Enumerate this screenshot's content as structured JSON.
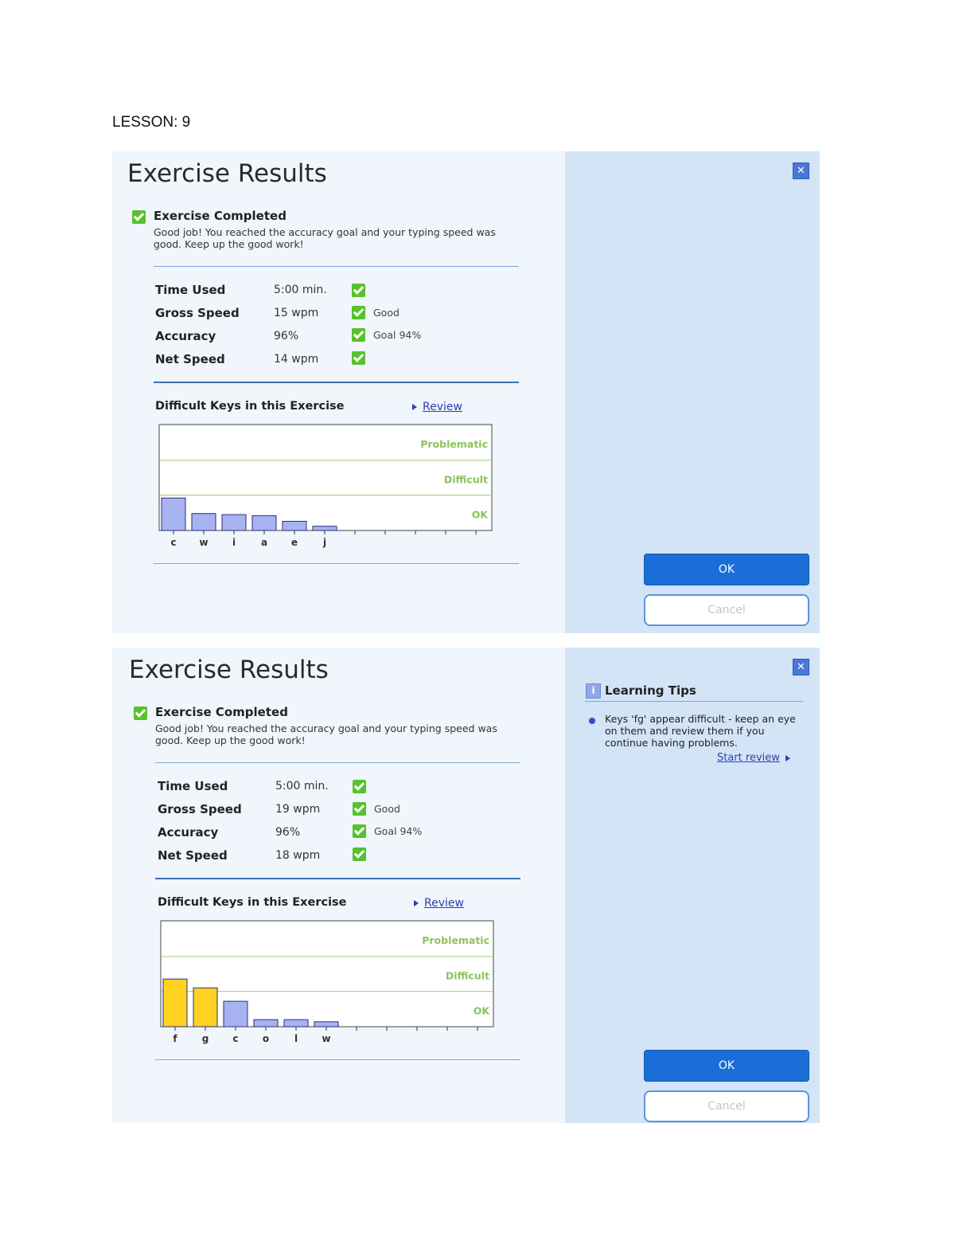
{
  "lesson_label": "LESSON: 9",
  "panels": [
    {
      "title": "Exercise Results",
      "completed_title": "Exercise Completed",
      "completed_message": "Good job! You reached the accuracy goal and your typing speed was good. Keep up the good work!",
      "stats": [
        {
          "label": "Time Used",
          "value": "5:00 min.",
          "note": ""
        },
        {
          "label": "Gross Speed",
          "value": "15 wpm",
          "note": "Good"
        },
        {
          "label": "Accuracy",
          "value": "96%",
          "note": "Goal 94%"
        },
        {
          "label": "Net Speed",
          "value": "14 wpm",
          "note": ""
        }
      ],
      "difficult_keys_title": "Difficult Keys in this Exercise",
      "review_label": "Review",
      "ok_label": "OK",
      "cancel_label": "Cancel",
      "chart_data": {
        "type": "bar",
        "categories": [
          "c",
          "w",
          "i",
          "a",
          "e",
          "j",
          "",
          "",
          "",
          "",
          ""
        ],
        "values": [
          0.92,
          0.48,
          0.45,
          0.42,
          0.26,
          0.12,
          0,
          0,
          0,
          0,
          0
        ],
        "colors": [
          "#a7b3f1",
          "#a7b3f1",
          "#a7b3f1",
          "#a7b3f1",
          "#a7b3f1",
          "#a7b3f1",
          "",
          "",
          "",
          "",
          ""
        ],
        "bands": [
          "Problematic",
          "Difficult",
          "OK"
        ],
        "ylim": [
          0,
          3
        ]
      }
    },
    {
      "title": "Exercise Results",
      "completed_title": "Exercise Completed",
      "completed_message": "Good job! You reached the accuracy goal and your typing speed was good. Keep up the good work!",
      "stats": [
        {
          "label": "Time Used",
          "value": "5:00 min.",
          "note": ""
        },
        {
          "label": "Gross Speed",
          "value": "19 wpm",
          "note": "Good"
        },
        {
          "label": "Accuracy",
          "value": "96%",
          "note": "Goal 94%"
        },
        {
          "label": "Net Speed",
          "value": "18 wpm",
          "note": ""
        }
      ],
      "difficult_keys_title": "Difficult Keys in this Exercise",
      "review_label": "Review",
      "ok_label": "OK",
      "cancel_label": "Cancel",
      "learning_tips": {
        "title": "Learning Tips",
        "icon_label": "i",
        "text": "Keys 'fg' appear difficult - keep an eye on them and review them if you continue having problems.",
        "link_label": "Start review"
      },
      "chart_data": {
        "type": "bar",
        "categories": [
          "f",
          "g",
          "c",
          "o",
          "l",
          "w",
          "",
          "",
          "",
          "",
          ""
        ],
        "values": [
          1.35,
          1.1,
          0.72,
          0.2,
          0.2,
          0.14,
          0,
          0,
          0,
          0,
          0
        ],
        "colors": [
          "#ffd21f",
          "#ffd21f",
          "#a7b3f1",
          "#a7b3f1",
          "#a7b3f1",
          "#a7b3f1",
          "",
          "",
          "",
          "",
          ""
        ],
        "bands": [
          "Problematic",
          "Difficult",
          "OK"
        ],
        "ylim": [
          0,
          3
        ]
      }
    }
  ]
}
